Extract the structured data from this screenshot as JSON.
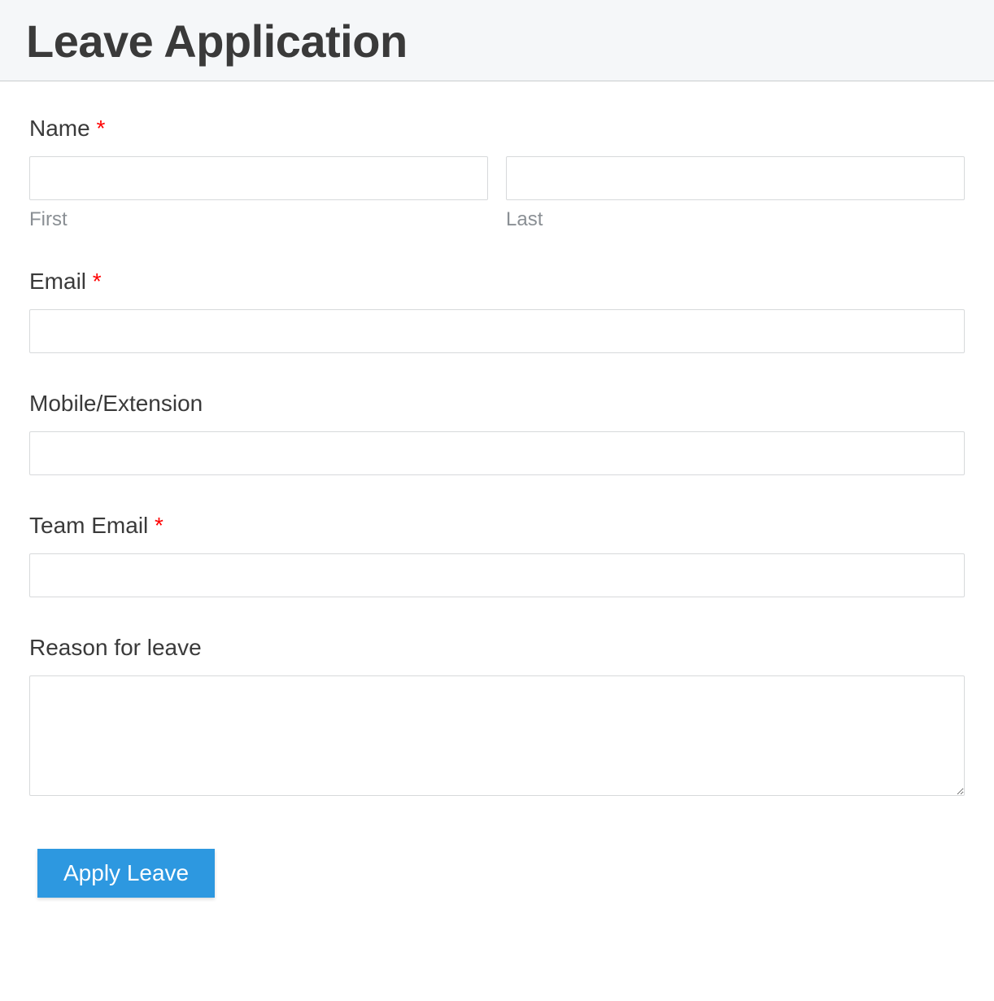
{
  "header": {
    "title": "Leave Application"
  },
  "form": {
    "name": {
      "label": "Name",
      "required_mark": "*",
      "first_sub": "First",
      "last_sub": "Last",
      "first_value": "",
      "last_value": ""
    },
    "email": {
      "label": "Email",
      "required_mark": "*",
      "value": ""
    },
    "mobile": {
      "label": "Mobile/Extension",
      "value": ""
    },
    "team_email": {
      "label": "Team Email",
      "required_mark": "*",
      "value": ""
    },
    "reason": {
      "label": "Reason for leave",
      "value": ""
    },
    "submit": {
      "label": "Apply Leave"
    }
  }
}
